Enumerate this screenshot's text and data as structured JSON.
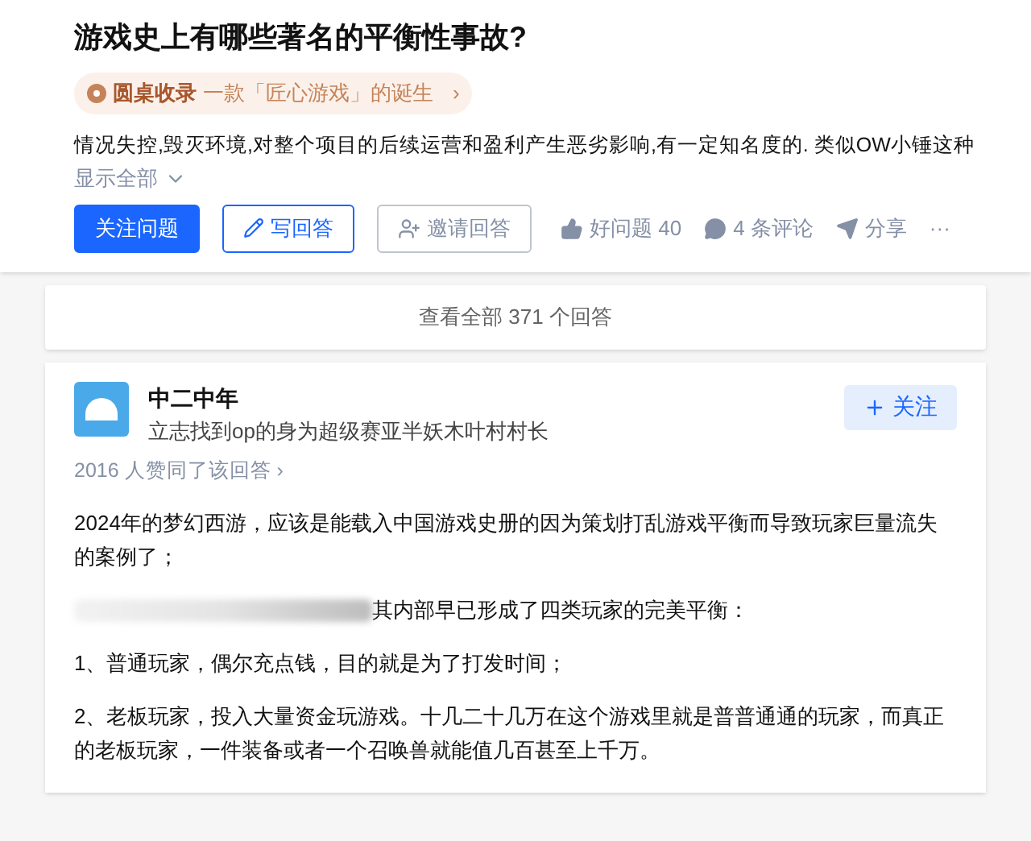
{
  "question": {
    "title": "游戏史上有哪些著名的平衡性事故?",
    "tag": {
      "label": "圆桌收录",
      "text": "一款「匠心游戏」的诞生",
      "chevron": "›"
    },
    "description": "情况失控,毁灭环境,对整个项目的后续运营和盈利产生恶劣影响,有一定知名度的. 类似OW小锤这种",
    "show_all": "显示全部",
    "actions": [
      {
        "kind": "primary",
        "label": "关注问题"
      },
      {
        "kind": "outline",
        "label": "写回答"
      },
      {
        "kind": "ghost",
        "label": "邀请回答"
      }
    ],
    "stats": [
      {
        "kind": "like",
        "label": "好问题 40"
      },
      {
        "kind": "comment",
        "label": "4 条评论"
      },
      {
        "kind": "share",
        "label": "分享"
      },
      {
        "kind": "more",
        "label": "···"
      }
    ]
  },
  "view_all": "查看全部 371 个回答",
  "answer": {
    "author": "中二中年",
    "bio": "立志找到op的身为超级赛亚半妖木叶村村长",
    "follow": "关注",
    "endorse": "2016 人赞同了该回答 ›",
    "paragraphs": [
      {
        "kind": "text",
        "text": "2024年的梦幻西游，应该是能载入中国游戏史册的因为策划打乱游戏平衡而导致玩家巨量流失的案例了；"
      },
      {
        "kind": "redacted",
        "text": "其内部早已形成了四类玩家的完美平衡："
      },
      {
        "kind": "text",
        "text": "1、普通玩家，偶尔充点钱，目的就是为了打发时间；"
      },
      {
        "kind": "text",
        "text": "2、老板玩家，投入大量资金玩游戏。十几二十几万在这个游戏里就是普普通通的玩家，而真正的老板玩家，一件装备或者一个召唤兽就能值几百甚至上千万。"
      }
    ]
  }
}
